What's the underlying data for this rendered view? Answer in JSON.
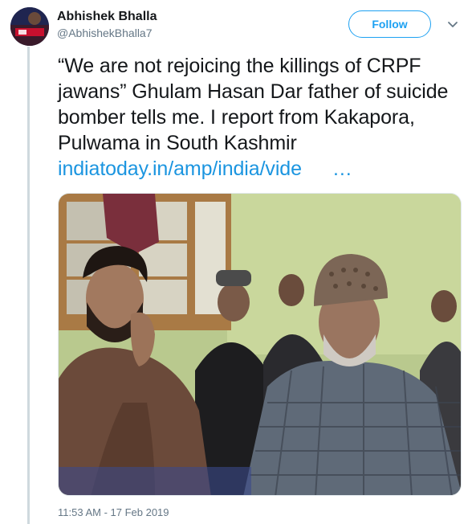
{
  "author": {
    "name": "Abhishek Bhalla",
    "handle": "@AbhishekBhalla7"
  },
  "follow_label": "Follow",
  "tweet": {
    "text": "“We are not rejoicing the killings of CRPF jawans” Ghulam Hasan Dar father of suicide bomber tells me. I report from Kakapora, Pulwama in South Kashmir",
    "link_text": "indiatoday.in/amp/india/vide",
    "link_ellipsis": "…"
  },
  "timestamp": "11:53 AM - 17 Feb 2019",
  "colors": {
    "accent": "#1da1f2",
    "link": "#1b95e0",
    "secondary_text": "#657786"
  },
  "icons": {
    "more": "chevron-down-icon"
  }
}
